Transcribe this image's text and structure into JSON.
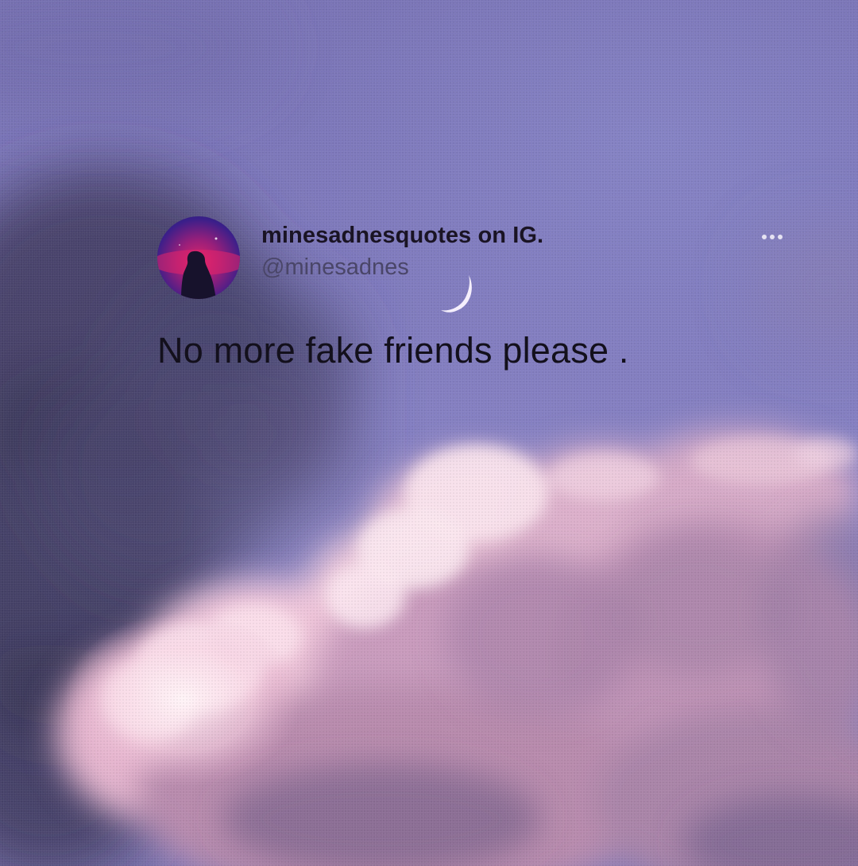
{
  "tweet": {
    "display_name": "minesadnesquotes on IG.",
    "handle": "@minesadnes",
    "text": "No more fake friends please ."
  },
  "icons": {
    "more": "more-horizontal-icon",
    "moon": "crescent-moon-icon"
  },
  "colors": {
    "sky_top": "#7a74b6",
    "sky_mid": "#8580c2",
    "cloud_pink": "#f0c8da",
    "cloud_dark": "#4a4570",
    "text": "#13101c",
    "handle": "#4a4668"
  }
}
